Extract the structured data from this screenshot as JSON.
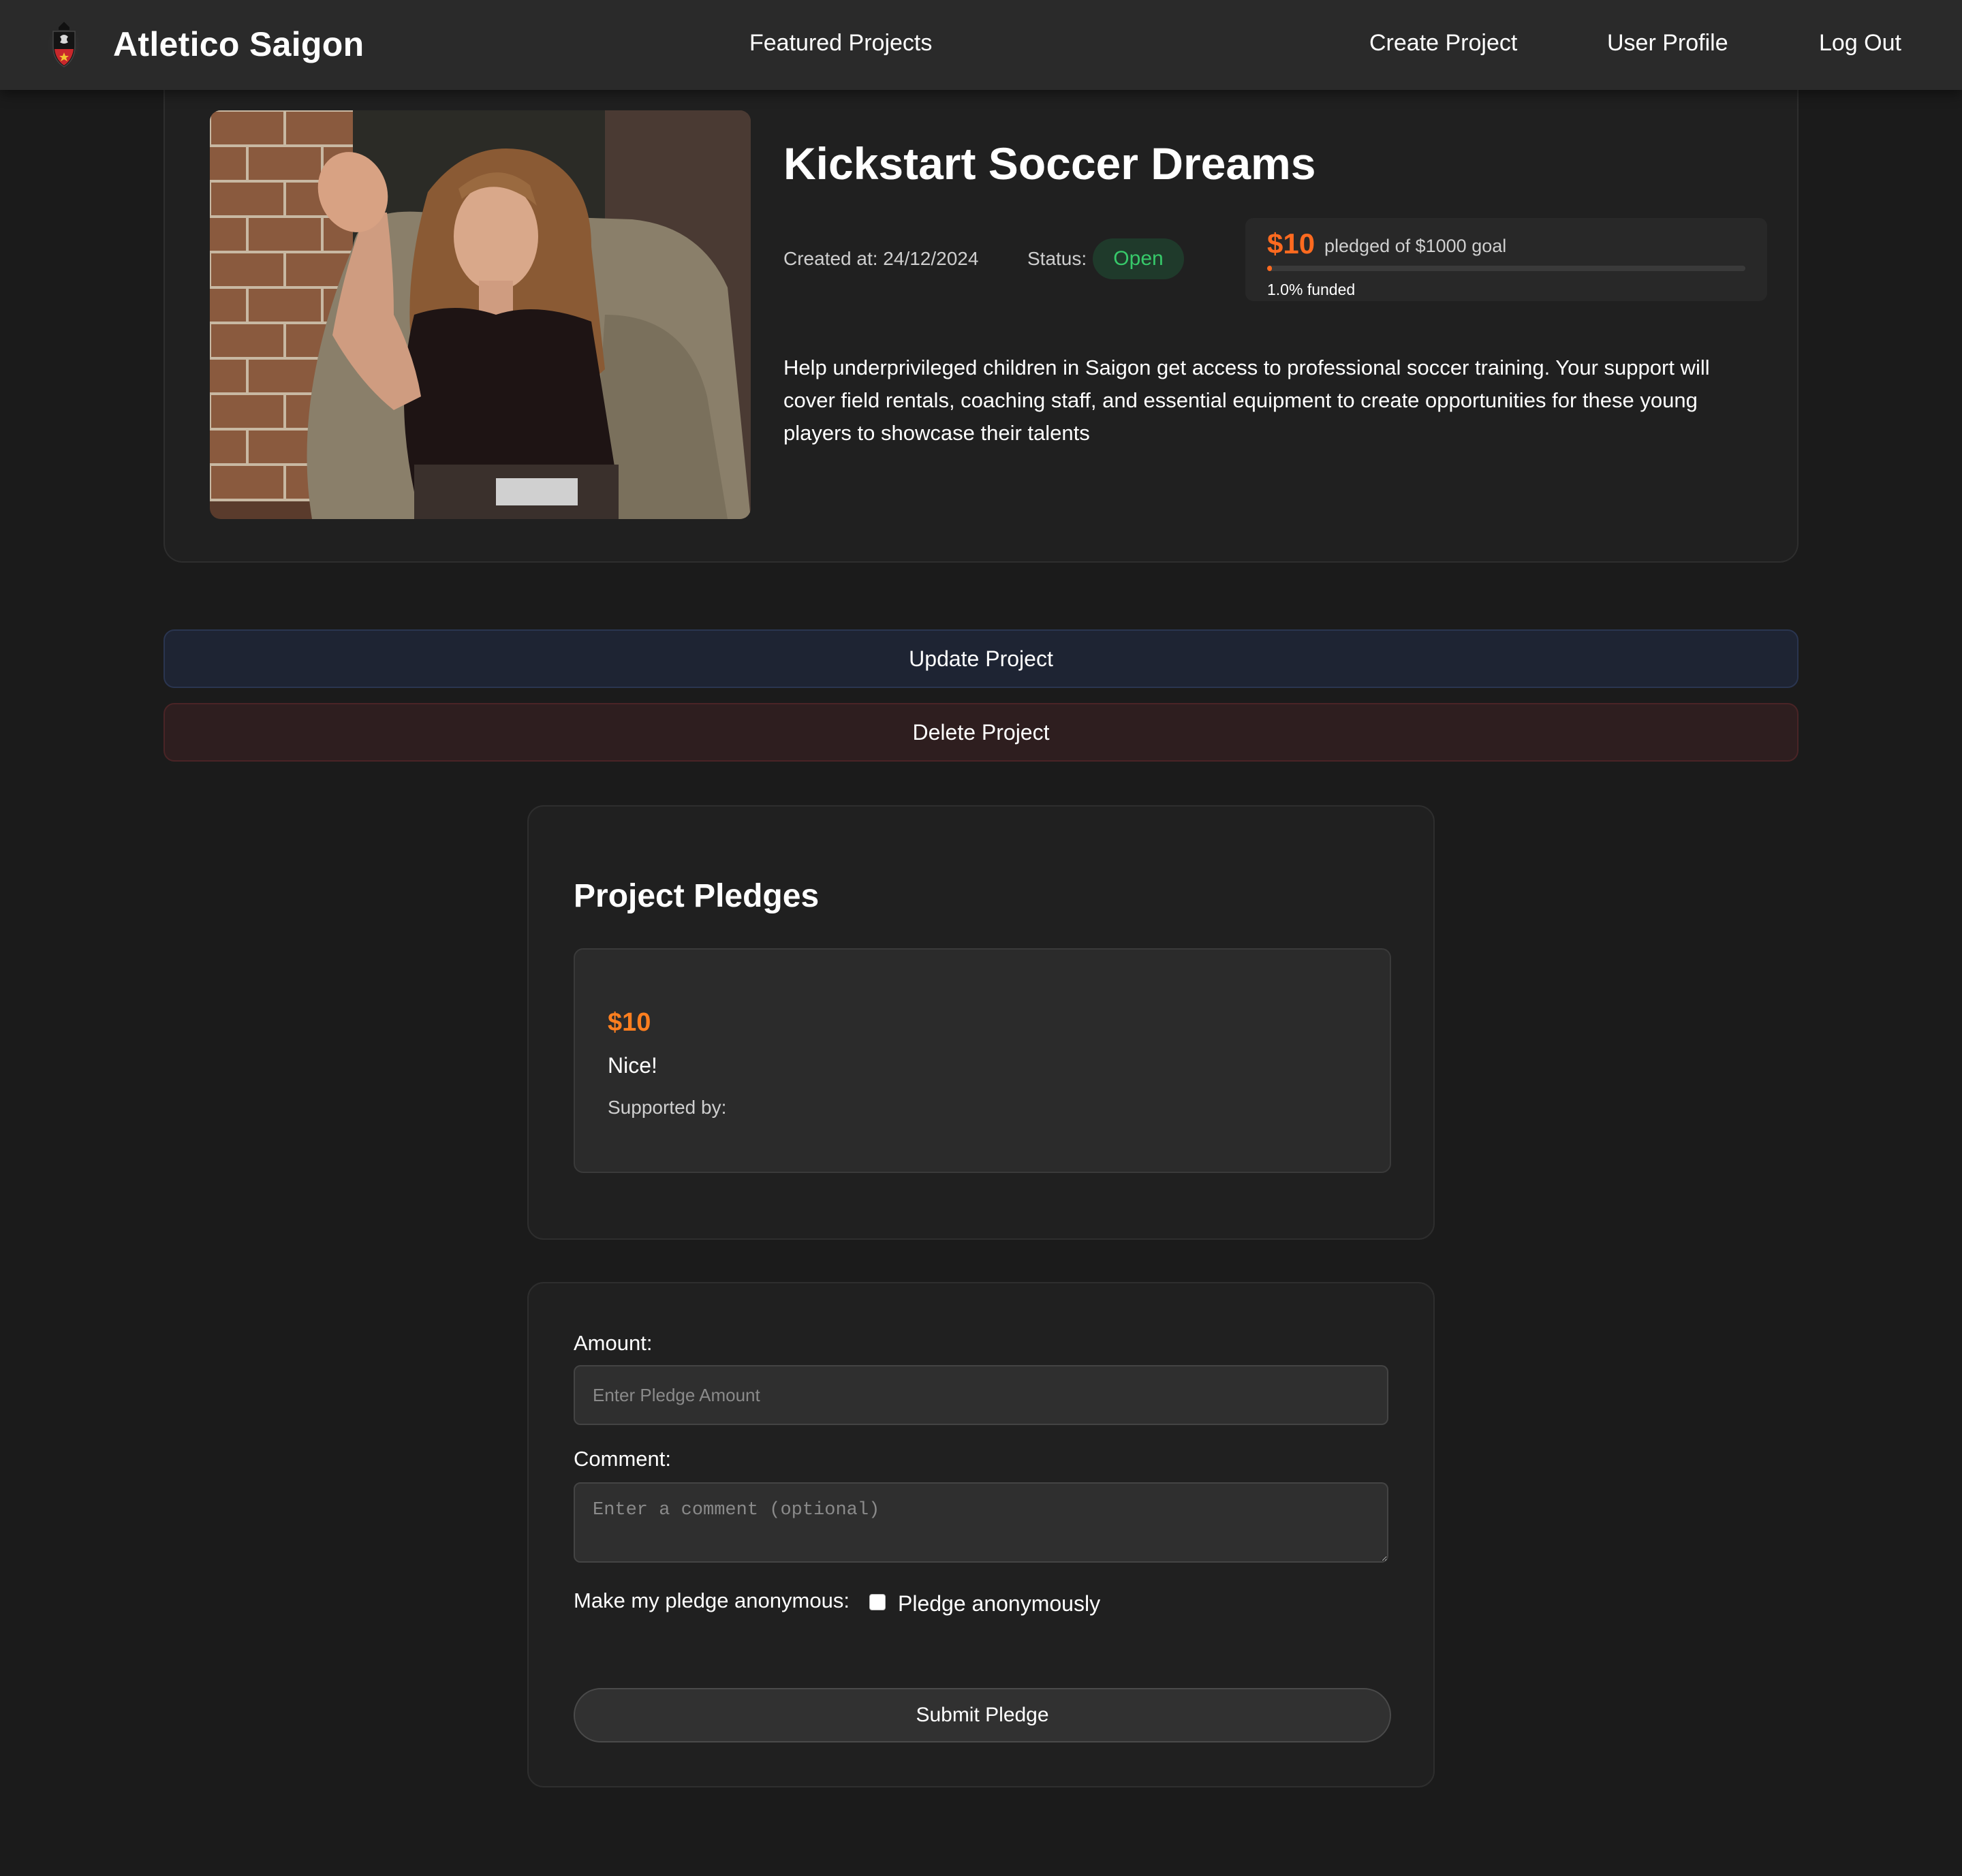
{
  "nav": {
    "brand": "Atletico Saigon",
    "logo_icon": "club-crest-icon",
    "links": {
      "featured": "Featured Projects",
      "create": "Create Project",
      "profile": "User Profile",
      "logout": "Log Out"
    }
  },
  "project": {
    "title": "Kickstart Soccer Dreams",
    "image_icon": "project-photo",
    "created_label": "Created at: 24/12/2024",
    "status_label": "Status:",
    "status": "Open",
    "pledged_amount": "$10",
    "goal_text": "pledged of $1000 goal",
    "funded_text": "1.0% funded",
    "funded_fraction": 0.01,
    "description": "Help underprivileged children in Saigon get access to professional soccer training. Your support will cover field rentals, coaching staff, and essential equipment to create opportunities for these young players to showcase their talents"
  },
  "actions": {
    "update": "Update Project",
    "delete": "Delete Project"
  },
  "pledges": {
    "title": "Project Pledges",
    "items": [
      {
        "amount": "$10",
        "comment": "Nice!",
        "supported_by": "Supported by:"
      }
    ]
  },
  "form": {
    "amount_label": "Amount:",
    "amount_placeholder": "Enter Pledge Amount",
    "comment_label": "Comment:",
    "comment_placeholder": "Enter a comment (optional)",
    "anon_label": "Make my pledge anonymous:",
    "anon_checkbox_text": "Pledge anonymously",
    "submit": "Submit Pledge"
  },
  "colors": {
    "accent": "#ff6a1f",
    "status_open": "#37c96a",
    "background": "#1b1b1b",
    "panel": "#202020"
  }
}
